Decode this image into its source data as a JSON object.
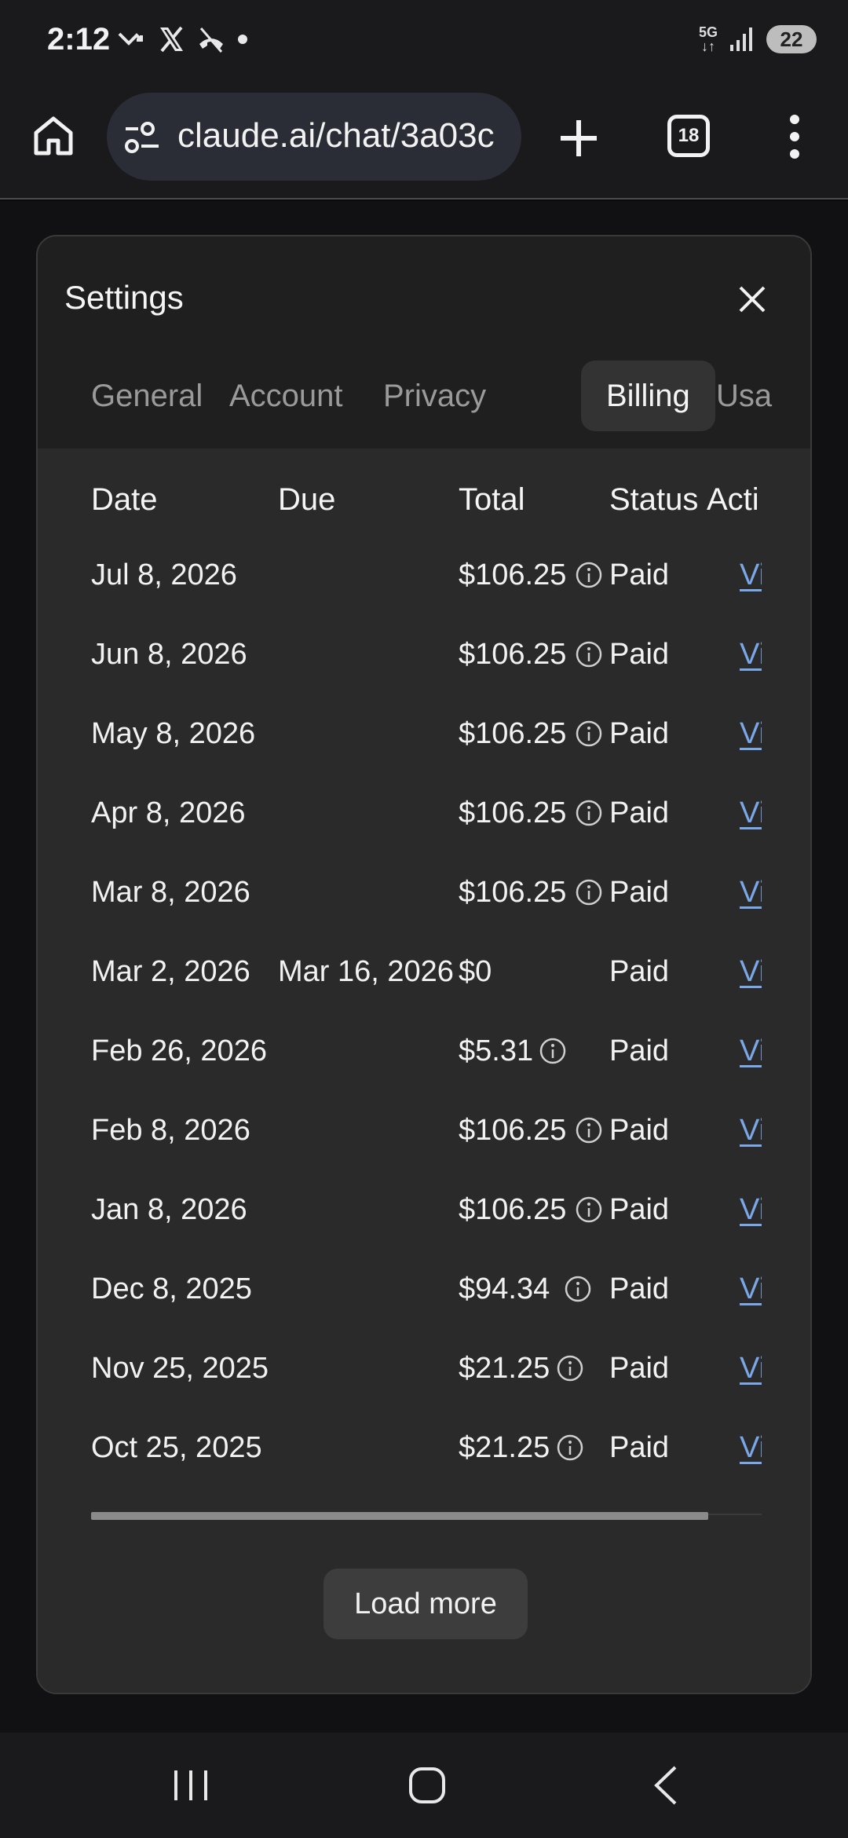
{
  "status_bar": {
    "time": "2:12",
    "network": "5G",
    "battery": "22"
  },
  "browser": {
    "url": "claude.ai/chat/3a03c",
    "tab_count": "18"
  },
  "settings": {
    "title": "Settings",
    "tabs": [
      {
        "label": "General",
        "active": false
      },
      {
        "label": "Account",
        "active": false
      },
      {
        "label": "Privacy",
        "active": false
      },
      {
        "label": "Billing",
        "active": true
      },
      {
        "label": "Usa",
        "active": false
      }
    ],
    "table": {
      "headers": {
        "date": "Date",
        "due": "Due",
        "total": "Total",
        "status": "Status",
        "actions": "Acti"
      },
      "rows": [
        {
          "date": "Jul 8, 2026",
          "due": "",
          "total": "$106.25",
          "info": true,
          "status": "Paid",
          "action": "View"
        },
        {
          "date": "Jun 8, 2026",
          "due": "",
          "total": "$106.25",
          "info": true,
          "status": "Paid",
          "action": "View"
        },
        {
          "date": "May 8, 2026",
          "due": "",
          "total": "$106.25",
          "info": true,
          "status": "Paid",
          "action": "View"
        },
        {
          "date": "Apr 8, 2026",
          "due": "",
          "total": "$106.25",
          "info": true,
          "status": "Paid",
          "action": "View"
        },
        {
          "date": "Mar 8, 2026",
          "due": "",
          "total": "$106.25",
          "info": true,
          "status": "Paid",
          "action": "View"
        },
        {
          "date": "Mar 2, 2026",
          "due": "Mar 16, 2026",
          "total": "$0",
          "info": false,
          "status": "Paid",
          "action": "View"
        },
        {
          "date": "Feb 26, 2026",
          "due": "",
          "total": "$5.31",
          "info": true,
          "status": "Paid",
          "action": "View"
        },
        {
          "date": "Feb 8, 2026",
          "due": "",
          "total": "$106.25",
          "info": true,
          "status": "Paid",
          "action": "View"
        },
        {
          "date": "Jan 8, 2026",
          "due": "",
          "total": "$106.25",
          "info": true,
          "status": "Paid",
          "action": "View"
        },
        {
          "date": "Dec 8, 2025",
          "due": "",
          "total": "$94.34",
          "info": true,
          "status": "Paid",
          "action": "View"
        },
        {
          "date": "Nov 25, 2025",
          "due": "",
          "total": "$21.25",
          "info": true,
          "status": "Paid",
          "action": "View"
        },
        {
          "date": "Oct 25, 2025",
          "due": "",
          "total": "$21.25",
          "info": true,
          "status": "Paid",
          "action": "View"
        }
      ]
    },
    "load_more_label": "Load more"
  },
  "colors": {
    "link": "#7aa7e8",
    "modal_bg": "#262626",
    "active_tab_bg": "#333333"
  },
  "icons": {
    "home": "home-icon",
    "site_settings": "tune-icon",
    "new_tab": "plus-icon",
    "menu": "more-vert-icon",
    "close": "close-icon",
    "info": "info-icon",
    "nav_recent": "recent-apps-icon",
    "nav_home": "nav-home-icon",
    "nav_back": "back-icon"
  }
}
